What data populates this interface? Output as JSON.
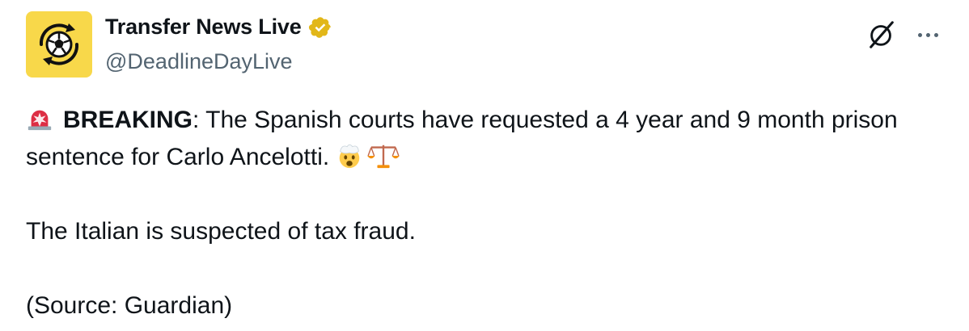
{
  "author": {
    "display_name": "Transfer News Live",
    "handle": "@DeadlineDayLive",
    "avatar_icon": "soccer-ball-transfer-icon",
    "verified_icon": "verified-badge-icon",
    "avatar_bg": "#f8d84a",
    "verified_color": "#e2b719"
  },
  "actions": {
    "grok_icon": "grok-icon",
    "more_icon": "more-options-icon"
  },
  "tweet": {
    "line1_prefix_icon": "police-siren-icon",
    "breaking_label": "BREAKING",
    "line1_text": ": The Spanish courts have requested a 4 year and 9 month prison sentence for Carlo Ancelotti.",
    "line1_suffix_icons": [
      "exploding-head-icon",
      "balance-scale-icon"
    ],
    "para2": "The Italian is suspected of tax fraud.",
    "para3": "(Source: Guardian)"
  }
}
